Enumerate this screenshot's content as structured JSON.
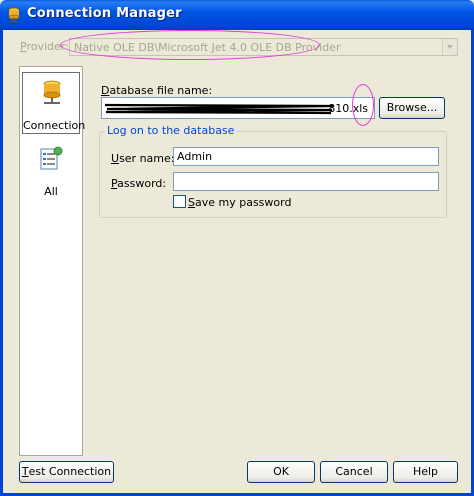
{
  "window": {
    "title": "Connection Manager"
  },
  "provider": {
    "label": "Provider:",
    "value": "Native OLE DB\\Microsoft Jet 4.0 OLE DB Provider"
  },
  "sidebar": {
    "items": [
      {
        "label": "Connection",
        "selected": true
      },
      {
        "label": "All",
        "selected": false
      }
    ]
  },
  "database": {
    "label": "Database file name:",
    "value_visible_suffix": "810.xls",
    "browse_label": "Browse..."
  },
  "logon": {
    "title": "Log on to the database",
    "user_label": "User name:",
    "user_value": "Admin",
    "password_label": "Password:",
    "password_value": "",
    "save_password_label": "Save my password",
    "save_password_checked": false
  },
  "buttons": {
    "test": "Test Connection",
    "ok": "OK",
    "cancel": "Cancel",
    "help": "Help"
  },
  "colors": {
    "title_bar": "#0055e5",
    "annotation": "#e03ad8",
    "group_title": "#0046d5"
  }
}
